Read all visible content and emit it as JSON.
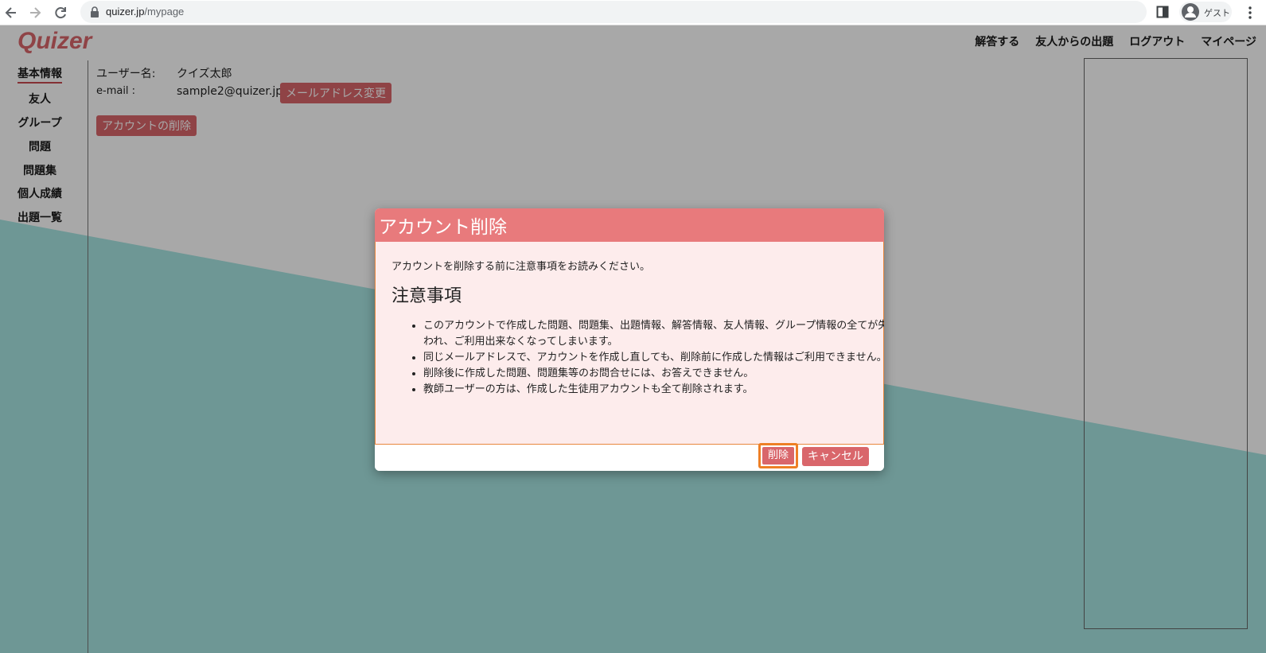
{
  "browser": {
    "url_host": "quizer.jp",
    "url_path": "/mypage",
    "profile_label": "ゲスト"
  },
  "header": {
    "logo": "Quizer",
    "nav": [
      "解答する",
      "友人からの出題",
      "ログアウト",
      "マイページ"
    ]
  },
  "sidebar": {
    "items": [
      "基本情報",
      "友人",
      "グループ",
      "問題",
      "問題集",
      "個人成績",
      "出題一覧"
    ],
    "active_index": 0
  },
  "profile": {
    "username_label": "ユーザー名:",
    "username_value": "クイズ太郎",
    "email_label": "e-mail :",
    "email_value": "sample2@quizer.jp",
    "change_email_button": "メールアドレス変更",
    "delete_account_button": "アカウントの削除"
  },
  "modal": {
    "title": "アカウント削除",
    "intro": "アカウントを削除する前に注意事項をお読みください。",
    "heading": "注意事項",
    "notes": [
      "このアカウントで作成した問題、問題集、出題情報、解答情報、友人情報、グループ情報の全てが失われ、ご利用出来なくなってしまいます。",
      "同じメールアドレスで、アカウントを作成し直しても、削除前に作成した情報はご利用できません。",
      "削除後に作成した問題、問題集等のお問合せには、お答えできません。",
      "教師ユーザーの方は、作成した生徒用アカウントも全て削除されます。"
    ],
    "delete_button": "削除",
    "cancel_button": "キャンセル"
  },
  "colors": {
    "accent": "#d9666b",
    "modal_header": "#e87a7c",
    "modal_body": "#fdecec",
    "background_teal": "#a7e5e3",
    "focus_outline": "#ee7f25"
  }
}
